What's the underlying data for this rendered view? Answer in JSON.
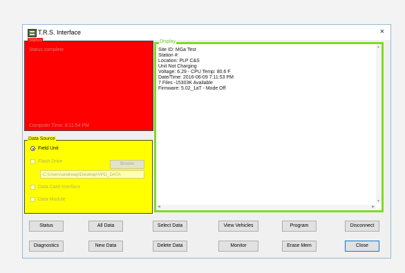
{
  "window": {
    "title": "T.R.S. Interface",
    "close_glyph": "×"
  },
  "status": {
    "legend": "Status",
    "message": "Status complete",
    "computer_time": "Computer Time: 8:11:54 PM",
    "bg_color": "#ff0000"
  },
  "data_source": {
    "legend": "Data Source",
    "bg_color": "#ffff00",
    "field_unit": {
      "label": "Field Unit",
      "selected": true
    },
    "flash_drive": {
      "label": "Flash Drive",
      "checked": false
    },
    "browse_label": "Browse",
    "path": "C:\\Users\\andrewp\\Desktop\\VPD_DATA",
    "data_card_interface": {
      "label": "Data Card Interface",
      "checked": false
    },
    "data_module": {
      "label": "Data Module",
      "checked": false
    }
  },
  "display": {
    "legend": "Display",
    "border_color": "#7dda26",
    "lines": [
      "Site ID: MGa Test",
      "Station #:",
      "Location: PLP C&S",
      "Unit Not Charging",
      "Voltage: 6.29 - CPU Temp: 80.6 F",
      "Date/Time: 2016-06-09 7:11:53 PM",
      "7 Files -15303K Available",
      "Firmware: 5.02_1aT - Mode Off"
    ]
  },
  "buttons": {
    "status": "Status",
    "all_data": "All Data",
    "select_data": "Select Data",
    "view_vehicles": "View Vehicles",
    "program": "Program",
    "disconnect": "Disconnect",
    "diagnostics": "Diagnostics",
    "new_data": "New Data",
    "delete_data": "Delete Data",
    "monitor": "Monitor",
    "erase_mem": "Erase Mem",
    "close": "Close"
  }
}
